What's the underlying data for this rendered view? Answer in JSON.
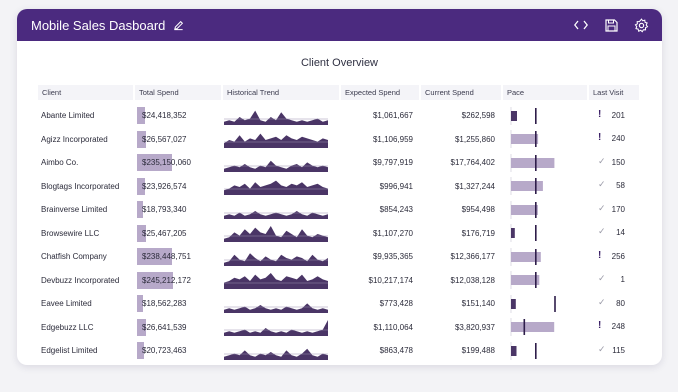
{
  "app": {
    "title": "Mobile Sales Dasboard",
    "accent": "#4b2a7f",
    "icons": [
      "edit-icon",
      "code-icon",
      "save-icon",
      "gear-icon"
    ]
  },
  "panel": {
    "title": "Client Overview"
  },
  "columns": {
    "client": "Client",
    "total_spend": "Total Spend",
    "trend": "Historical Trend",
    "expected": "Expected Spend",
    "current": "Current Spend",
    "pace": "Pace",
    "last_visit": "Last Visit"
  },
  "rows": [
    {
      "client": "Abante Limited",
      "total_spend": "$24,418,352",
      "spend_frac": 0.14,
      "expected": "$1,061,667",
      "current": "$262,598",
      "pace_actual": 0.25,
      "pace_target": 1.0,
      "alert": true,
      "last_visit": "201",
      "trend": [
        2,
        3,
        2,
        5,
        3,
        4,
        9,
        3,
        2,
        5,
        3,
        8,
        4,
        3,
        2,
        3,
        2,
        3,
        4,
        2,
        3
      ]
    },
    {
      "client": "Agizz Incorporated",
      "total_spend": "$26,567,027",
      "spend_frac": 0.16,
      "expected": "$1,106,959",
      "current": "$1,255,860",
      "pace_actual": 1.13,
      "pace_target": 1.0,
      "alert": true,
      "last_visit": "240",
      "trend": [
        3,
        5,
        4,
        8,
        4,
        6,
        5,
        9,
        5,
        6,
        7,
        5,
        8,
        6,
        5,
        7,
        6,
        5,
        4,
        6,
        5
      ]
    },
    {
      "client": "Aimbo Co.",
      "total_spend": "$235,150,060",
      "spend_frac": 0.96,
      "expected": "$9,797,919",
      "current": "$17,764,402",
      "pace_actual": 1.81,
      "pace_target": 1.0,
      "alert": false,
      "last_visit": "150",
      "trend": [
        2,
        3,
        4,
        3,
        5,
        3,
        2,
        4,
        3,
        7,
        4,
        3,
        2,
        4,
        5,
        3,
        6,
        4,
        3,
        4,
        3
      ]
    },
    {
      "client": "Blogtags Incorporated",
      "total_spend": "$23,926,574",
      "spend_frac": 0.13,
      "expected": "$996,941",
      "current": "$1,327,244",
      "pace_actual": 1.33,
      "pace_target": 1.0,
      "alert": false,
      "last_visit": "58",
      "trend": [
        3,
        4,
        6,
        5,
        7,
        4,
        8,
        5,
        6,
        7,
        9,
        6,
        5,
        7,
        6,
        8,
        5,
        6,
        7,
        5,
        4
      ]
    },
    {
      "client": "Brainverse Limited",
      "total_spend": "$18,793,340",
      "spend_frac": 0.07,
      "expected": "$854,243",
      "current": "$954,498",
      "pace_actual": 1.12,
      "pace_target": 1.0,
      "alert": false,
      "last_visit": "170",
      "trend": [
        2,
        3,
        2,
        4,
        2,
        3,
        5,
        3,
        2,
        3,
        4,
        3,
        2,
        3,
        5,
        3,
        2,
        4,
        3,
        2,
        3
      ]
    },
    {
      "client": "Browsewire LLC",
      "total_spend": "$25,467,205",
      "spend_frac": 0.15,
      "expected": "$1,107,270",
      "current": "$176,719",
      "pace_actual": 0.16,
      "pace_target": 1.0,
      "alert": false,
      "last_visit": "14",
      "trend": [
        2,
        3,
        6,
        4,
        8,
        5,
        9,
        6,
        5,
        10,
        4,
        3,
        7,
        5,
        3,
        8,
        4,
        3,
        5,
        4,
        3
      ]
    },
    {
      "client": "Chatfish Company",
      "total_spend": "$238,448,751",
      "spend_frac": 0.98,
      "expected": "$9,935,365",
      "current": "$12,366,177",
      "pace_actual": 1.24,
      "pace_target": 1.0,
      "alert": true,
      "last_visit": "256",
      "trend": [
        2,
        3,
        7,
        4,
        3,
        8,
        5,
        3,
        6,
        4,
        3,
        7,
        5,
        4,
        6,
        5,
        3,
        7,
        4,
        3,
        5
      ]
    },
    {
      "client": "Devbuzz Incorporated",
      "total_spend": "$245,212,172",
      "spend_frac": 1.0,
      "expected": "$10,217,174",
      "current": "$12,038,128",
      "pace_actual": 1.18,
      "pace_target": 1.0,
      "alert": false,
      "last_visit": "1",
      "trend": [
        4,
        5,
        7,
        6,
        8,
        5,
        9,
        6,
        7,
        10,
        6,
        5,
        8,
        7,
        6,
        9,
        5,
        6,
        8,
        6,
        5
      ]
    },
    {
      "client": "Eavee Limited",
      "total_spend": "$18,562,283",
      "spend_frac": 0.07,
      "expected": "$773,428",
      "current": "$151,140",
      "pace_actual": 0.2,
      "pace_target": 1.8,
      "alert": false,
      "last_visit": "80",
      "trend": [
        2,
        3,
        2,
        3,
        4,
        2,
        3,
        5,
        3,
        2,
        3,
        2,
        4,
        3,
        2,
        3,
        6,
        3,
        2,
        3,
        2
      ]
    },
    {
      "client": "Edgebuzz LLC",
      "total_spend": "$26,641,539",
      "spend_frac": 0.16,
      "expected": "$1,110,064",
      "current": "$3,820,937",
      "pace_actual": 1.8,
      "pace_target": 0.52,
      "alert": true,
      "last_visit": "248",
      "trend": [
        2,
        3,
        2,
        3,
        4,
        2,
        3,
        2,
        5,
        3,
        2,
        3,
        2,
        4,
        3,
        2,
        3,
        2,
        3,
        4,
        10
      ]
    },
    {
      "client": "Edgelist Limited",
      "total_spend": "$20,723,463",
      "spend_frac": 0.09,
      "expected": "$863,478",
      "current": "$199,488",
      "pace_actual": 0.23,
      "pace_target": 1.0,
      "alert": false,
      "last_visit": "115",
      "trend": [
        2,
        3,
        4,
        3,
        6,
        3,
        2,
        4,
        3,
        5,
        3,
        2,
        6,
        3,
        2,
        4,
        7,
        3,
        2,
        4,
        3
      ]
    }
  ]
}
